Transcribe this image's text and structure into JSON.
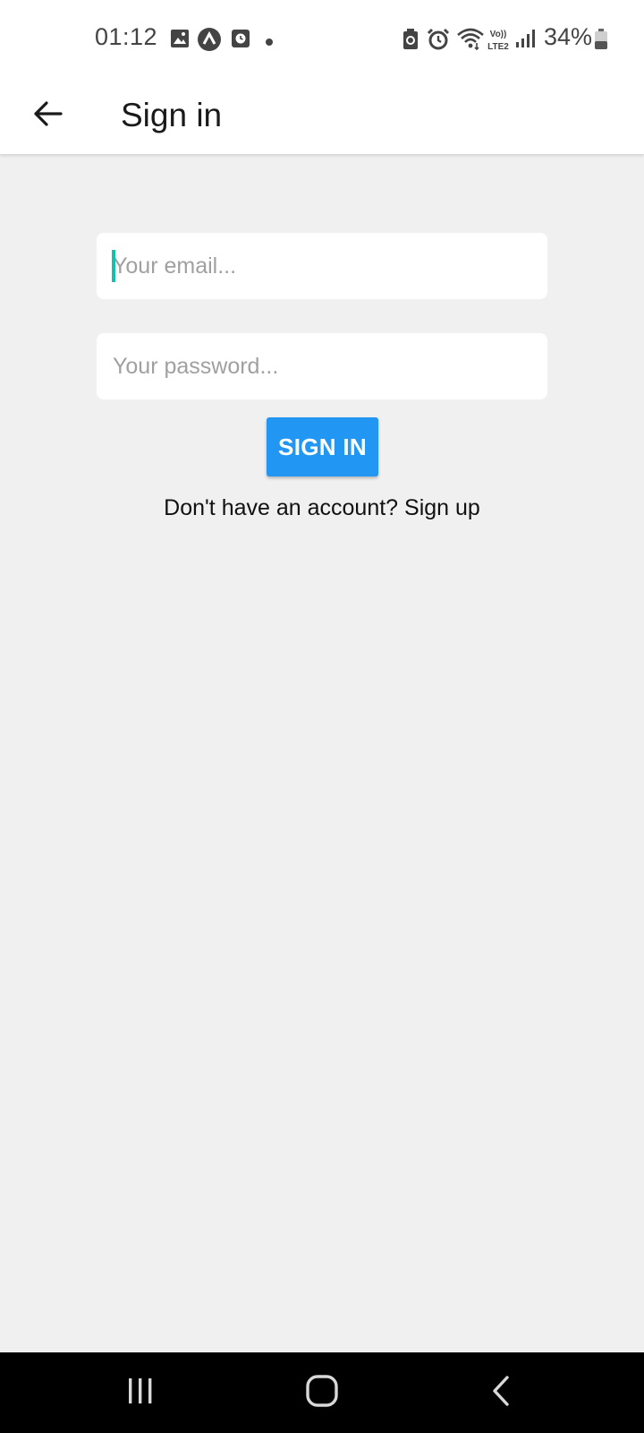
{
  "status_bar": {
    "time": "01:12",
    "battery": "34%",
    "left_icons": [
      "gallery-icon",
      "app-a-icon",
      "clock-app-icon",
      "dot-icon"
    ],
    "right_icons": [
      "battery-saver-icon",
      "alarm-icon",
      "wifi-icon",
      "volte-lte2-icon",
      "signal-icon",
      "battery-icon"
    ],
    "network_label": "Vo)) LTE2"
  },
  "app_bar": {
    "title": "Sign in",
    "back_icon": "arrow-left-icon"
  },
  "form": {
    "email_placeholder": "Your email...",
    "email_value": "",
    "password_placeholder": "Your password...",
    "password_value": "",
    "submit_label": "SIGN IN",
    "signup_prompt": "Don't have an account?",
    "signup_link": "Sign up"
  },
  "nav_bar": {
    "recents_icon": "recents-icon",
    "home_icon": "home-icon",
    "back_icon": "back-chevron-icon"
  },
  "colors": {
    "accent": "#2196f3",
    "background": "#f0f0f0",
    "caret": "#16bfae"
  }
}
